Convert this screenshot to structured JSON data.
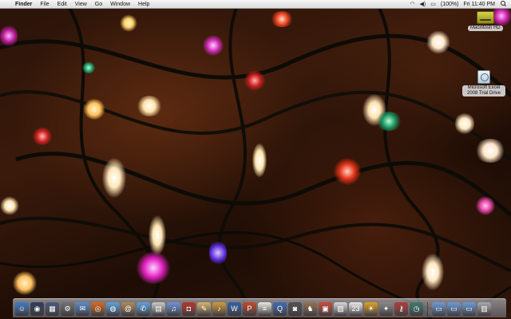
{
  "menubar": {
    "apple_symbol": "",
    "items": [
      "Finder",
      "File",
      "Edit",
      "View",
      "Go",
      "Window",
      "Help"
    ],
    "status_icons": [
      "wifi-icon",
      "volume-icon",
      "battery-icon"
    ],
    "battery": "(100%)",
    "clock": "Fri 11:40 PM"
  },
  "desktop": {
    "icons": [
      {
        "label": "Macintosh HD",
        "icon": "hard-drive-icon"
      },
      {
        "label": "Microsoft Excel 2008 Trial Drive",
        "icon": "disk-image-icon"
      }
    ]
  },
  "dock": {
    "apps": [
      {
        "name": "finder-icon",
        "glyph": "☺",
        "color": "#3d78c8"
      },
      {
        "name": "dashboard-icon",
        "glyph": "◉",
        "color": "#2b3b5a"
      },
      {
        "name": "spaces-icon",
        "glyph": "▦",
        "color": "#4a5a78"
      },
      {
        "name": "system-preferences-icon",
        "glyph": "⚙",
        "color": "#707070"
      },
      {
        "name": "mail-icon",
        "glyph": "✉",
        "color": "#5a8ad0"
      },
      {
        "name": "firefox-icon",
        "glyph": "◎",
        "color": "#d8681c"
      },
      {
        "name": "safari-icon",
        "glyph": "◍",
        "color": "#5ca0d8"
      },
      {
        "name": "address-book-icon",
        "glyph": "@",
        "color": "#b08858"
      },
      {
        "name": "ichat-icon",
        "glyph": "✆",
        "color": "#5fa0e0"
      },
      {
        "name": "calendar-icon",
        "glyph": "▤",
        "color": "#c7c7c7"
      },
      {
        "name": "itunes-icon",
        "glyph": "♫",
        "color": "#6b94d8"
      },
      {
        "name": "photo-booth-icon",
        "glyph": "◘",
        "color": "#b5342a"
      },
      {
        "name": "preview-icon",
        "glyph": "✎",
        "color": "#d6b46a"
      },
      {
        "name": "garageband-icon",
        "glyph": "♪",
        "color": "#d09a3a"
      },
      {
        "name": "word-icon",
        "glyph": "W",
        "color": "#2f5ea8"
      },
      {
        "name": "powerpoint-icon",
        "glyph": "P",
        "color": "#c0482a"
      },
      {
        "name": "textedit-icon",
        "glyph": "≡",
        "color": "#e8e8e0"
      },
      {
        "name": "quicktime-icon",
        "glyph": "Q",
        "color": "#3a6ab8"
      },
      {
        "name": "dvd-player-icon",
        "glyph": "◙",
        "color": "#505050"
      },
      {
        "name": "chess-icon",
        "glyph": "♞",
        "color": "#907050"
      },
      {
        "name": "photo-icon",
        "glyph": "▣",
        "color": "#c84a3a"
      },
      {
        "name": "pdf-icon",
        "glyph": "▧",
        "color": "#d8d8d8"
      },
      {
        "name": "ical-icon",
        "glyph": "23",
        "color": "#e8e8e8"
      },
      {
        "name": "sun-icon",
        "glyph": "☀",
        "color": "#e0a020"
      },
      {
        "name": "utility-icon",
        "glyph": "✦",
        "color": "#888888"
      },
      {
        "name": "keychain-icon",
        "glyph": "⚷",
        "color": "#b03a3a"
      },
      {
        "name": "time-machine-icon",
        "glyph": "◷",
        "color": "#3a7a6a"
      }
    ],
    "folders": [
      {
        "name": "applications-folder-icon",
        "glyph": "▭",
        "color": "#6a9ad8"
      },
      {
        "name": "documents-folder-icon",
        "glyph": "▭",
        "color": "#6a9ad8"
      },
      {
        "name": "downloads-folder-icon",
        "glyph": "▭",
        "color": "#6a9ad8"
      },
      {
        "name": "trash-icon",
        "glyph": "▥",
        "color": "#a8a8b0"
      }
    ]
  }
}
